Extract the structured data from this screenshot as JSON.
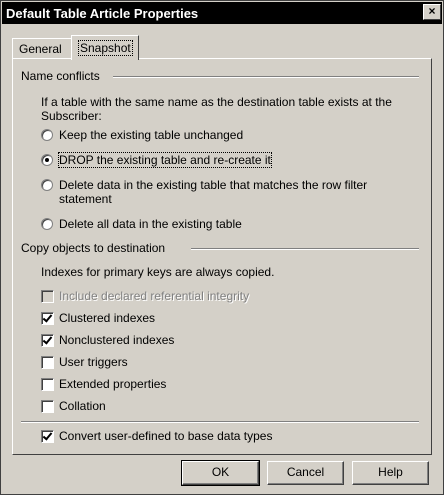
{
  "window": {
    "title": "Default Table Article Properties",
    "close_glyph": "×"
  },
  "tabs": [
    {
      "label": "General",
      "selected": false
    },
    {
      "label": "Snapshot",
      "selected": true
    }
  ],
  "name_conflicts": {
    "heading": "Name conflicts",
    "description": "If a table with the same name as the destination table exists at the Subscriber:",
    "options": [
      {
        "label": "Keep the existing table unchanged",
        "selected": false
      },
      {
        "label": "DROP the existing table and re-create it",
        "selected": true
      },
      {
        "label_line1": "Delete data in the existing table that matches the row filter",
        "label_line2": "statement",
        "selected": false
      },
      {
        "label": "Delete all data in the existing table",
        "selected": false
      }
    ]
  },
  "copy_objects": {
    "heading": "Copy objects to destination",
    "description": "Indexes for primary keys are always copied.",
    "checkboxes": [
      {
        "label": "Include declared referential integrity",
        "checked": false,
        "enabled": false
      },
      {
        "label": "Clustered indexes",
        "checked": true,
        "enabled": true
      },
      {
        "label": "Nonclustered indexes",
        "checked": true,
        "enabled": true
      },
      {
        "label": "User triggers",
        "checked": false,
        "enabled": true
      },
      {
        "label": "Extended properties",
        "checked": false,
        "enabled": true
      },
      {
        "label": "Collation",
        "checked": false,
        "enabled": true
      }
    ]
  },
  "convert_types": {
    "label": "Convert user-defined to base data types",
    "checked": true
  },
  "buttons": {
    "ok": "OK",
    "cancel": "Cancel",
    "help": "Help"
  }
}
